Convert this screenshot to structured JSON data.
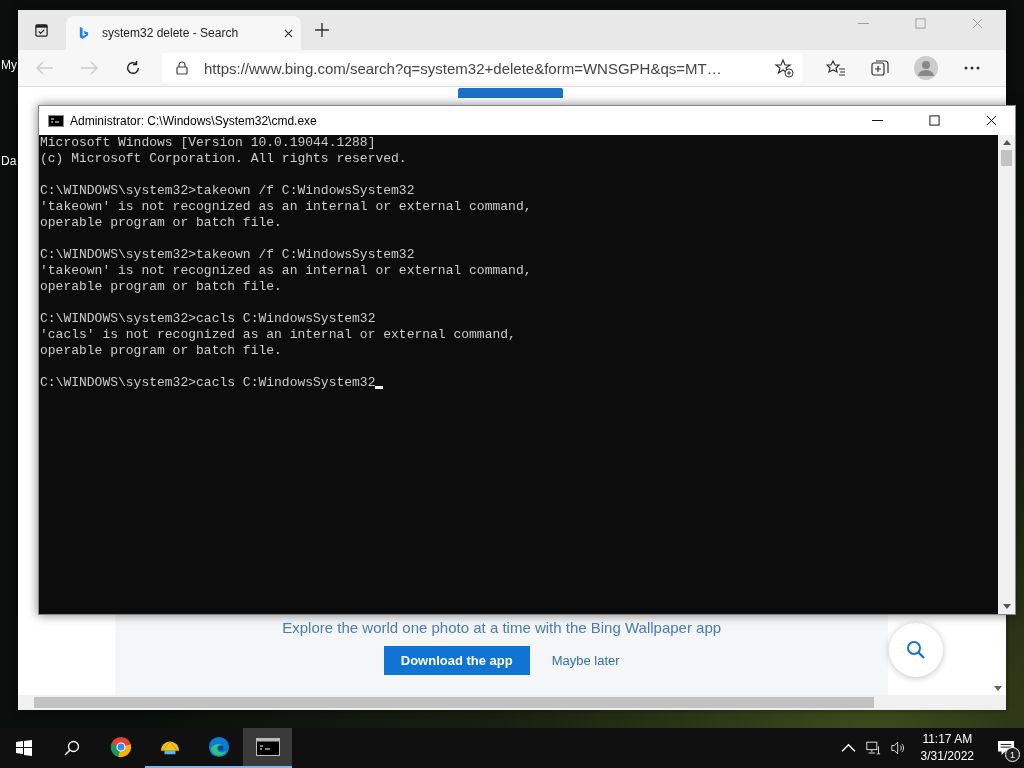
{
  "desktop": {
    "icon_labels": [
      "My",
      "Da"
    ]
  },
  "browser": {
    "tab": {
      "title": "system32 delete - Search",
      "selected": true
    },
    "address": "https://www.bing.com/search?q=system32+delete&form=WNSGPH&qs=MT…",
    "page": {
      "promo_text": "Explore the world one photo at a time with the Bing Wallpaper app",
      "primary_button": "Download the app",
      "secondary_link": "Maybe later"
    }
  },
  "console": {
    "title": "Administrator: C:\\Windows\\System32\\cmd.exe",
    "cursor": true,
    "blocks": [
      [
        "Microsoft Windows [Version 10.0.19044.1288]",
        "(c) Microsoft Corporation. All rights reserved."
      ],
      [
        "C:\\WINDOWS\\system32>takeown /f C:WindowsSystem32",
        "'takeown' is not recognized as an internal or external command,",
        "operable program or batch file."
      ],
      [
        "C:\\WINDOWS\\system32>takeown /f C:WindowsSystem32",
        "'takeown' is not recognized as an internal or external command,",
        "operable program or batch file."
      ],
      [
        "C:\\WINDOWS\\system32>cacls C:WindowsSystem32",
        "'cacls' is not recognized as an internal or external command,",
        "operable program or batch file."
      ],
      [
        "C:\\WINDOWS\\system32>cacls C:WindowsSystem32"
      ]
    ]
  },
  "taskbar": {
    "apps": [
      {
        "kind": "chrome",
        "running": false,
        "selected": false
      },
      {
        "kind": "shell",
        "running": true,
        "selected": false
      },
      {
        "kind": "edge",
        "running": true,
        "selected": false
      },
      {
        "kind": "console",
        "running": true,
        "selected": true
      }
    ],
    "time": "11:17 AM",
    "date": "3/31/2022",
    "notification_count": "1"
  }
}
